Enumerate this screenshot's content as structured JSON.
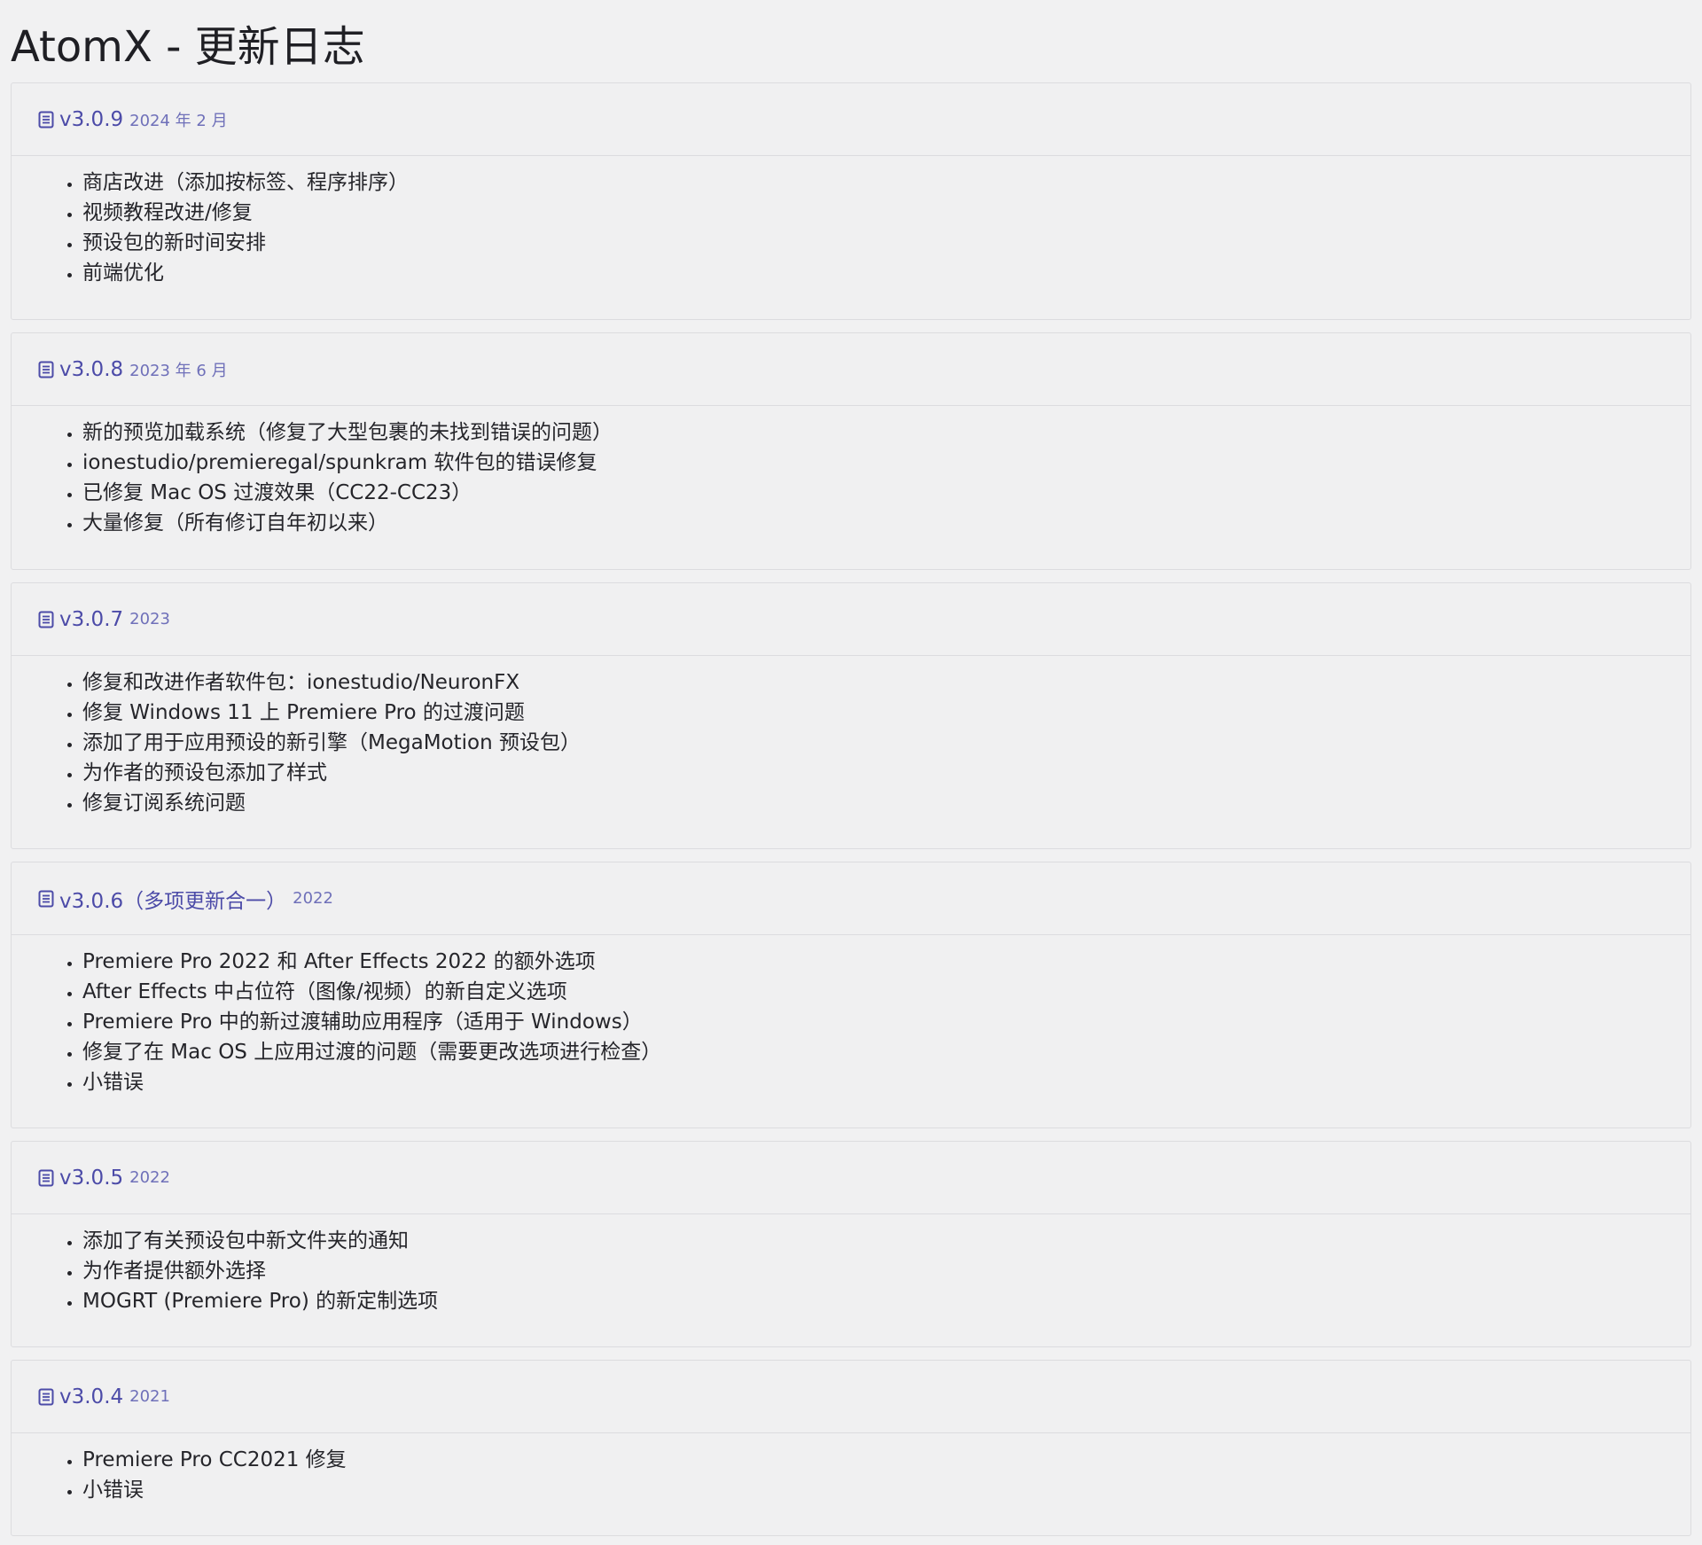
{
  "page": {
    "title": "AtomX - 更新日志"
  },
  "icons": {
    "entry_icon": "document-icon",
    "accent_color": "#4c4ba8"
  },
  "changelog": [
    {
      "version": "v3.0.9",
      "date": "2024 年 2 月",
      "items": [
        "商店改进（添加按标签、程序排序）",
        "视频教程改进/修复",
        "预设包的新时间安排",
        "前端优化"
      ]
    },
    {
      "version": "v3.0.8",
      "date": "2023 年 6 月",
      "items": [
        "新的预览加载系统（修复了大型包裹的未找到错误的问题）",
        "ionestudio/premieregal/spunkram 软件包的错误修复",
        "已修复 Mac OS 过渡效果（CC22-CC23）",
        "大量修复（所有修订自年初以来）"
      ]
    },
    {
      "version": "v3.0.7",
      "date": "2023",
      "items": [
        "修复和改进作者软件包：ionestudio/NeuronFX",
        "修复 Windows 11 上 Premiere Pro 的过渡问题",
        "添加了用于应用预设的新引擎（MegaMotion 预设包）",
        "为作者的预设包添加了样式",
        "修复订阅系统问题"
      ]
    },
    {
      "version": "v3.0.6（多项更新合一）",
      "date": "2022",
      "items": [
        "Premiere Pro 2022 和 After Effects 2022 的额外选项",
        "After Effects 中占位符（图像/视频）的新自定义选项",
        "Premiere Pro 中的新过渡辅助应用程序（适用于 Windows）",
        "修复了在 Mac OS 上应用过渡的问题（需要更改选项进行检查）",
        "小错误"
      ]
    },
    {
      "version": "v3.0.5",
      "date": "2022",
      "items": [
        "添加了有关预设包中新文件夹的通知",
        "为作者提供额外选择",
        "MOGRT (Premiere Pro) 的新定制选项"
      ]
    },
    {
      "version": "v3.0.4",
      "date": "2021",
      "items": [
        "Premiere Pro CC2021 修复",
        "小错误"
      ]
    }
  ]
}
